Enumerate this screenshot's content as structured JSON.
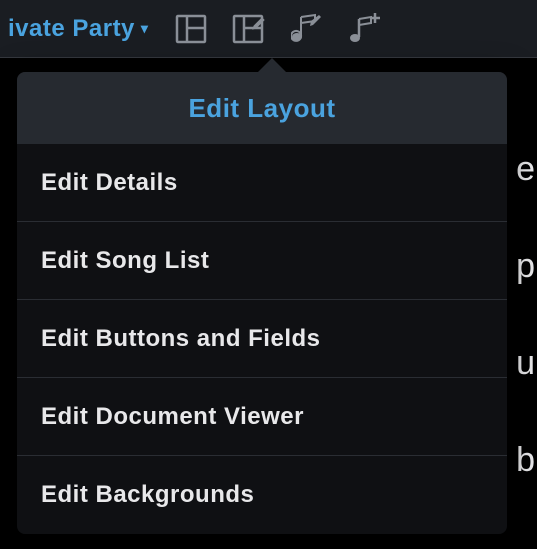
{
  "toolbar": {
    "dropdown_label": "ivate Party",
    "dropdown_arrow": "▾"
  },
  "popover": {
    "title": "Edit Layout",
    "items": [
      {
        "label": "Edit Details"
      },
      {
        "label": "Edit Song List"
      },
      {
        "label": "Edit Buttons and Fields"
      },
      {
        "label": "Edit Document Viewer"
      },
      {
        "label": "Edit Backgrounds"
      }
    ]
  },
  "bg_hints": [
    "e",
    "p",
    "u",
    "b"
  ],
  "colors": {
    "accent": "#4aa3df",
    "panel": "#262a30",
    "popover_bg": "#0f1013",
    "toolbar_bg": "#1a1d22"
  }
}
